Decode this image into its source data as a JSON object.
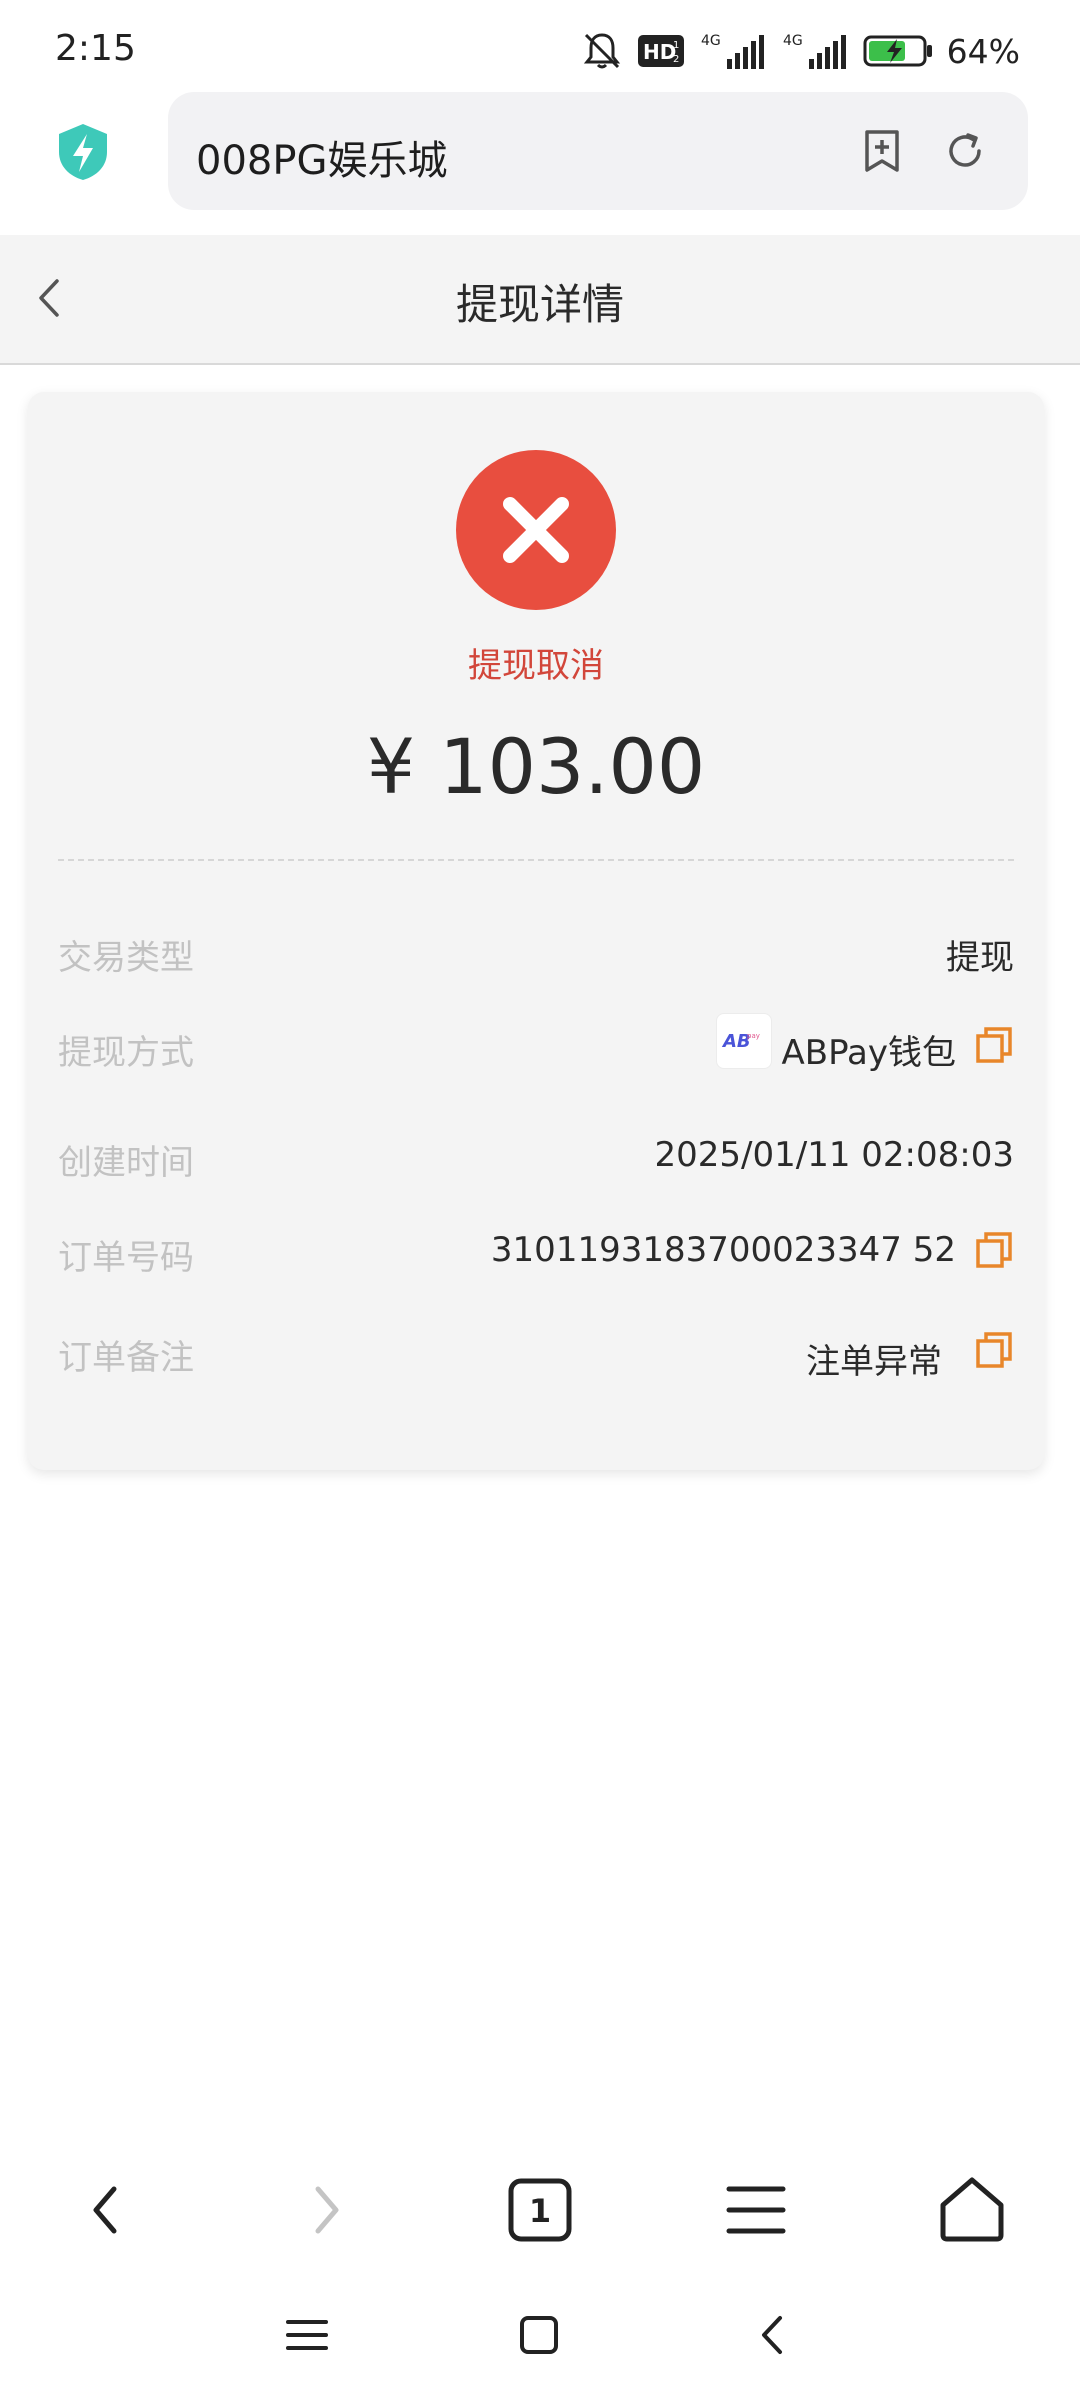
{
  "status_bar": {
    "time": "2:15",
    "hd_label": "HD",
    "network_1": "4G",
    "network_2": "4G",
    "battery_percent": "64%"
  },
  "browser": {
    "url_title": "008PG娱乐城"
  },
  "page": {
    "title": "提现详情"
  },
  "detail": {
    "status_text": "提现取消",
    "status_color": "#e84e3f",
    "amount": "¥ 103.00",
    "rows": [
      {
        "label": "交易类型",
        "value": "提现"
      },
      {
        "label": "提现方式",
        "value": "ABPay钱包"
      },
      {
        "label": "创建时间",
        "value": "2025/01/11 02:08:03"
      },
      {
        "label": "订单号码",
        "value": "3101193183700023347 52"
      },
      {
        "label": "订单备注",
        "value": "注单异常"
      }
    ]
  },
  "icons": {
    "shield": "shield-bolt-icon",
    "bookmark_add": "bookmark-add-icon",
    "reload": "reload-icon",
    "back": "chevron-left-icon",
    "copy": "copy-icon",
    "tab_count": "1"
  },
  "accent_color": "#e8862a"
}
